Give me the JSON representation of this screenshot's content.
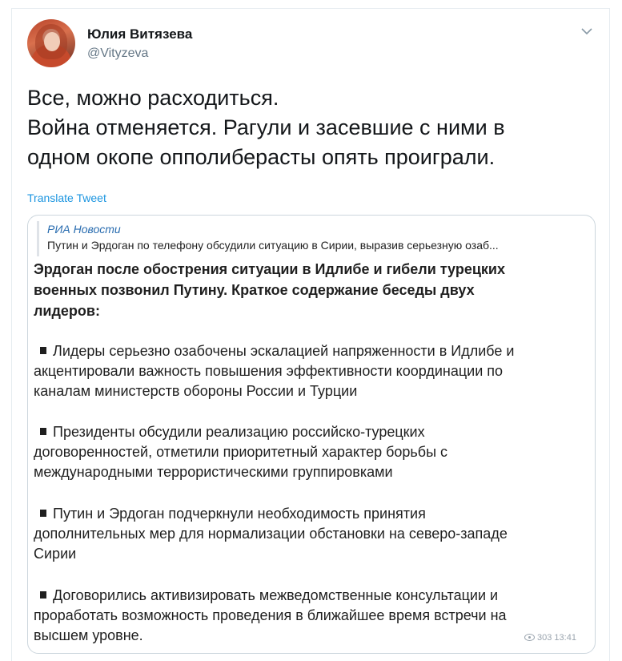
{
  "author": {
    "name": "Юлия Витязева",
    "handle": "@Vityzeva"
  },
  "tweet": {
    "lines": [
      "Все, можно расходиться.",
      "Война отменяется. Рагули и засевшие с ними в",
      "одном окопе опполиберасты опять проиграли."
    ],
    "translate_label": "Translate Tweet"
  },
  "card": {
    "source": "РИА Новости",
    "summary": "Путин и Эрдоган по телефону обсудили ситуацию в Сирии, выразив серьезную озаб...",
    "headline_lines": [
      "Эрдоган после обострения ситуации в Идлибе и гибели турецких",
      "военных позвонил Путину. Краткое содержание беседы двух",
      "лидеров:"
    ],
    "bullets": [
      {
        "lines": [
          "Лидеры серьезно озабочены эскалацией напряженности в Идлибе и",
          "акцентировали важность повышения эффективности координации по",
          "каналам министерств обороны России и Турции"
        ]
      },
      {
        "lines": [
          "Президенты обсудили реализацию российско-турецких",
          "договоренностей, отметили приоритетный характер борьбы с",
          "международными террористическими группировками"
        ]
      },
      {
        "lines": [
          "Путин и Эрдоган подчеркнули необходимость принятия",
          "дополнительных мер для нормализации обстановки на северо-западе",
          "Сирии"
        ]
      },
      {
        "lines": [
          "Договорились активизировать межведомственные консультации и",
          "проработать возможность проведения в ближайшее время встречи на",
          "высшем уровне."
        ]
      }
    ],
    "views": "303",
    "time": "13:41"
  },
  "icons": {
    "menu": "chevron-down-icon",
    "views": "eye-icon"
  },
  "colors": {
    "link": "#1b95e0",
    "handle": "#657786",
    "source": "#2a6db0"
  }
}
